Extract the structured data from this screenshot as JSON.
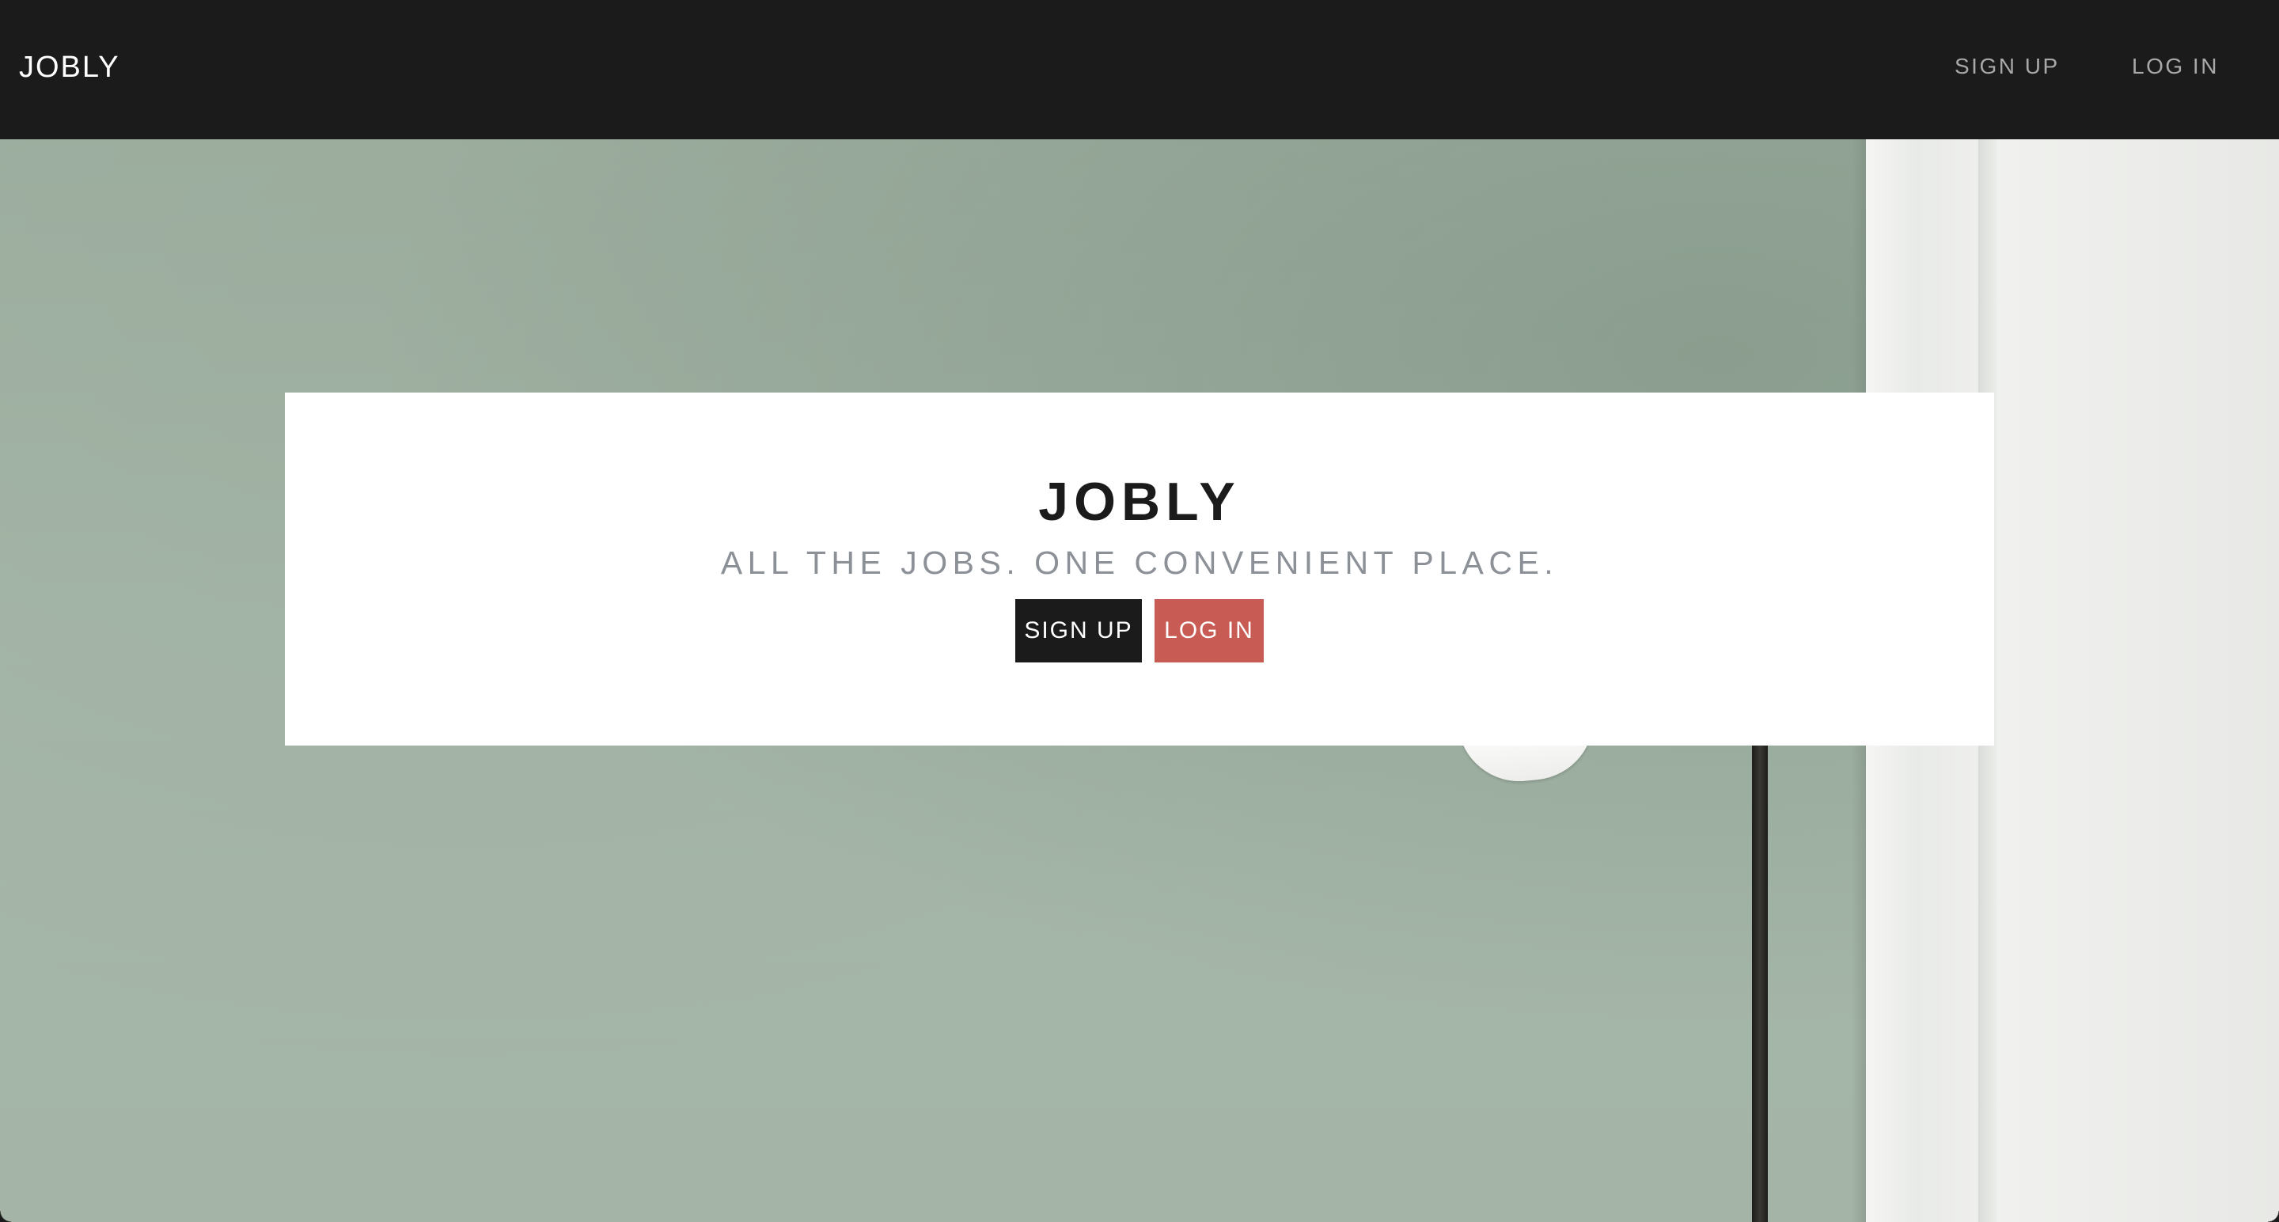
{
  "navbar": {
    "brand": "JOBLY",
    "links": {
      "signup": "SIGN UP",
      "login": "LOG IN"
    },
    "background_color": "#1b1b1b"
  },
  "hero": {
    "title": "JOBLY",
    "tagline": "ALL THE JOBS. ONE CONVENIENT PLACE.",
    "buttons": {
      "signup": "SIGN UP",
      "login": "LOG IN"
    },
    "colors": {
      "signup_button": "#1b1b1b",
      "login_button": "#c95b55",
      "tagline": "#8c9198"
    }
  },
  "background": {
    "image": "sage-green-wall-with-floor-lamp"
  }
}
